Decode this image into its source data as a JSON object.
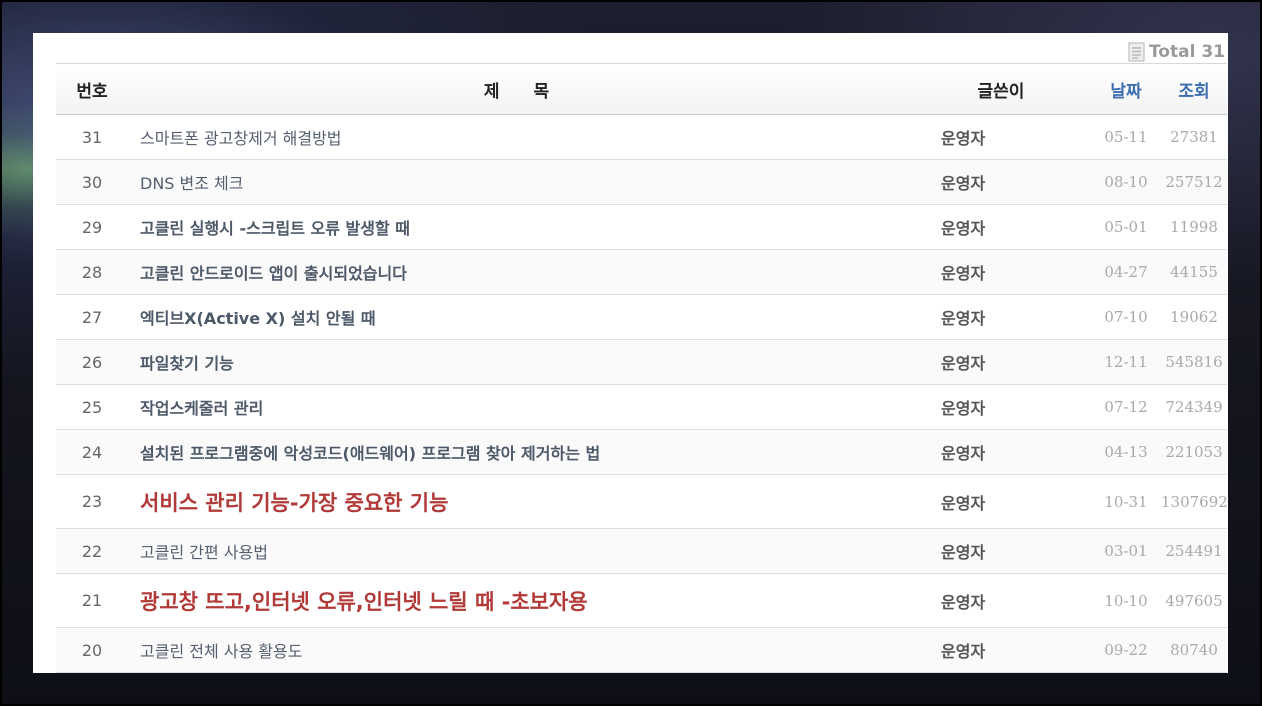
{
  "board": {
    "total_label": "Total 31",
    "columns": {
      "no": "번호",
      "title": "제 목",
      "writer": "글쓴이",
      "date": "날짜",
      "views": "조회"
    },
    "rows": [
      {
        "no": "31",
        "title": "스마트폰 광고창제거 해결방법",
        "writer": "운영자",
        "date": "05-11",
        "views": "27381",
        "style": "normal"
      },
      {
        "no": "30",
        "title": "DNS 변조 체크",
        "writer": "운영자",
        "date": "08-10",
        "views": "257512",
        "style": "normal"
      },
      {
        "no": "29",
        "title": "고클린 실행시 -스크립트 오류 발생할 때",
        "writer": "운영자",
        "date": "05-01",
        "views": "11998",
        "style": "bold"
      },
      {
        "no": "28",
        "title": "고클린 안드로이드 앱이 출시되었습니다",
        "writer": "운영자",
        "date": "04-27",
        "views": "44155",
        "style": "bold"
      },
      {
        "no": "27",
        "title": "엑티브X(Active X) 설치 안될 때",
        "writer": "운영자",
        "date": "07-10",
        "views": "19062",
        "style": "bold"
      },
      {
        "no": "26",
        "title": "파일찾기 기능",
        "writer": "운영자",
        "date": "12-11",
        "views": "545816",
        "style": "bold"
      },
      {
        "no": "25",
        "title": "작업스케줄러 관리",
        "writer": "운영자",
        "date": "07-12",
        "views": "724349",
        "style": "bold"
      },
      {
        "no": "24",
        "title": "설치된 프로그램중에 악성코드(애드웨어) 프로그램 찾아 제거하는 법",
        "writer": "운영자",
        "date": "04-13",
        "views": "221053",
        "style": "bold"
      },
      {
        "no": "23",
        "title": "서비스 관리 기능-가장 중요한 기능",
        "writer": "운영자",
        "date": "10-31",
        "views": "1307692",
        "style": "red"
      },
      {
        "no": "22",
        "title": "고클린 간편 사용법",
        "writer": "운영자",
        "date": "03-01",
        "views": "254491",
        "style": "normal"
      },
      {
        "no": "21",
        "title": "광고창 뜨고,인터넷 오류,인터넷 느릴 때 -초보자용",
        "writer": "운영자",
        "date": "10-10",
        "views": "497605",
        "style": "red"
      },
      {
        "no": "20",
        "title": "고클린 전체 사용 활용도",
        "writer": "운영자",
        "date": "09-22",
        "views": "80740",
        "style": "normal"
      }
    ]
  },
  "colors": {
    "accent_red": "#b13a38",
    "header_blue": "#3c6eb0",
    "meta_gray": "#a9a9a9"
  },
  "icons": {
    "total": "document-list-icon"
  }
}
